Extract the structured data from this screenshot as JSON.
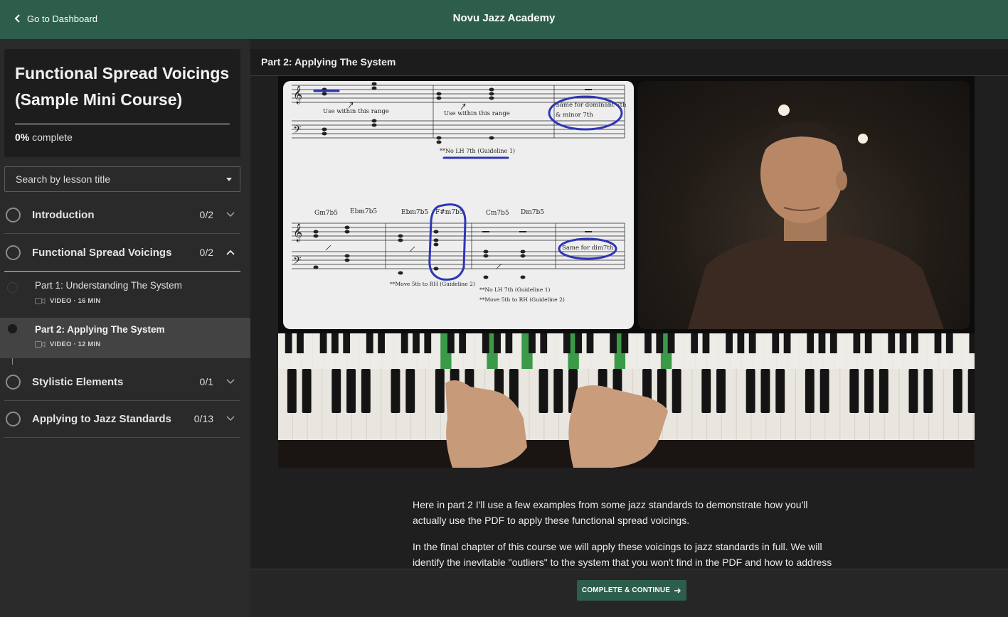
{
  "topbar": {
    "back_label": "Go to Dashboard",
    "app_title": "Novu Jazz Academy"
  },
  "course": {
    "title": "Functional Spread Voicings (Sample Mini Course)",
    "progress_percent": 0,
    "progress_value": "0%",
    "progress_suffix": "complete"
  },
  "search": {
    "placeholder": "Search by lesson title"
  },
  "sections": [
    {
      "title": "Introduction",
      "count": "0/2",
      "expanded": false
    },
    {
      "title": "Functional Spread Voicings",
      "count": "0/2",
      "expanded": true,
      "lessons": [
        {
          "title": "Part 1: Understanding The System",
          "meta": "VIDEO · 16 MIN",
          "active": false
        },
        {
          "title": "Part 2: Applying The System",
          "meta": "VIDEO · 12 MIN",
          "active": true
        }
      ]
    },
    {
      "title": "Stylistic Elements",
      "count": "0/1",
      "expanded": false
    },
    {
      "title": "Applying to Jazz Standards",
      "count": "0/13",
      "expanded": false
    }
  ],
  "main": {
    "lesson_title": "Part 2: Applying The System",
    "video": {
      "sheet_texts": {
        "use_range_1": "Use within this range",
        "use_range_2": "Use within this range",
        "dominant_note": "Same for dominant 7th",
        "minor_note": "& minor 7th",
        "no_lh_1": "**No LH 7th (Guideline 1)",
        "chords": [
          "Gm7b5",
          "Ebm7b5",
          "Ebm7b5",
          "F#m7b5",
          "Cm7b5",
          "Dm7b5"
        ],
        "dim_note": "Same for dim7th",
        "move_5th_1": "**Move 5th to RH (Guideline 2)",
        "no_lh_2": "**No LH 7th (Guideline 1)",
        "move_5th_2": "**Move 5th to RH (Guideline 2)"
      }
    },
    "description": [
      "Here in part 2 I'll use a few examples from some jazz standards to demonstrate how you'll actually use the PDF to apply these functional spread voicings.",
      "In the final chapter of this course we will apply these voicings to jazz standards in full. We will identify the inevitable \"outliers\" to the system that you won't find in the PDF and how to address"
    ]
  },
  "footer": {
    "cta_label": "COMPLETE & CONTINUE"
  },
  "colors": {
    "brand_green": "#2d5e4c",
    "annotation_blue": "#2e35b8",
    "key_highlight": "#3a9a48"
  },
  "icons": [
    "chevron-left-icon",
    "caret-down-icon",
    "chevron-down-icon",
    "chevron-up-icon",
    "video-camera-icon",
    "arrow-right-icon"
  ]
}
